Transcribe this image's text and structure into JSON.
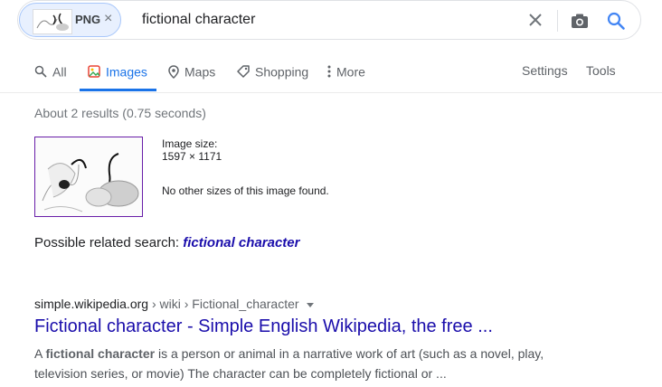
{
  "search": {
    "chip_label": "PNG",
    "chip_close": "×",
    "query": "fictional character"
  },
  "tabs": [
    {
      "label": "All",
      "icon": "search-icon"
    },
    {
      "label": "Images",
      "icon": "image-icon",
      "active": true
    },
    {
      "label": "Maps",
      "icon": "map-pin-icon"
    },
    {
      "label": "Shopping",
      "icon": "tag-icon"
    },
    {
      "label": "More",
      "icon": "more-vert-icon"
    }
  ],
  "tools": {
    "settings": "Settings",
    "tools": "Tools"
  },
  "result_stats": "About 2 results (0.75 seconds)",
  "image_info": {
    "size_label": "Image size:",
    "size_value": "1597 × 1171",
    "no_other": "No other sizes of this image found."
  },
  "related": {
    "prefix": "Possible related search:",
    "link": "fictional character"
  },
  "result": {
    "domain": "simple.wikipedia.org",
    "path": " › wiki › Fictional_character",
    "title": "Fictional character - Simple English Wikipedia, the free ...",
    "snippet_a": "A ",
    "snippet_b": "fictional character",
    "snippet_c": " is a person or animal in a narrative work of art (such as a novel, play, television series, or movie) The character can be completely fictional or ..."
  },
  "colors": {
    "accent": "#1a73e8",
    "link": "#1a0dab",
    "visited_border": "#681da8"
  }
}
